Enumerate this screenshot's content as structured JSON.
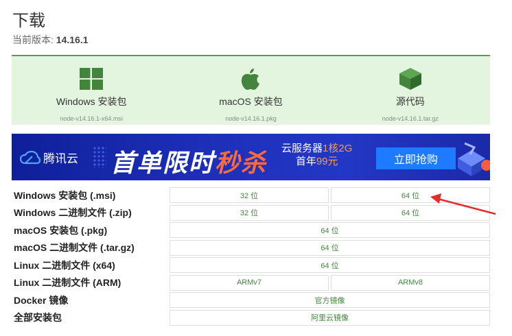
{
  "page": {
    "title": "下载",
    "version_label": "当前版本:",
    "version_value": "14.16.1"
  },
  "downloads": [
    {
      "icon": "windows-icon",
      "name": "Windows 安装包",
      "file": "node-v14.16.1-x64.msi"
    },
    {
      "icon": "apple-icon",
      "name": "macOS 安装包",
      "file": "node-v14.16.1.pkg"
    },
    {
      "icon": "box-icon",
      "name": "源代码",
      "file": "node-v14.16.1.tar.gz"
    }
  ],
  "banner": {
    "brand": "腾讯云",
    "headline_part1": "首单限时",
    "headline_part2": "秒杀",
    "sub_line1_a": "云服务器",
    "sub_line1_b": "1核2G",
    "sub_line2_a": "首年",
    "sub_line2_b": "99元",
    "button": "立即抢购"
  },
  "table": [
    {
      "label": "Windows 安装包 (.msi)",
      "cells": [
        "32 位",
        "64 位"
      ]
    },
    {
      "label": "Windows 二进制文件 (.zip)",
      "cells": [
        "32 位",
        "64 位"
      ]
    },
    {
      "label": "macOS 安装包 (.pkg)",
      "cells": [
        "64 位"
      ]
    },
    {
      "label": "macOS 二进制文件 (.tar.gz)",
      "cells": [
        "64 位"
      ]
    },
    {
      "label": "Linux 二进制文件 (x64)",
      "cells": [
        "64 位"
      ]
    },
    {
      "label": "Linux 二进制文件 (ARM)",
      "cells": [
        "ARMv7",
        "ARMv8"
      ]
    },
    {
      "label": "Docker 镜像",
      "cells": [
        "官方镜像"
      ]
    },
    {
      "label": "全部安装包",
      "cells": [
        "阿里云镜像"
      ]
    }
  ],
  "colors": {
    "accent_green": "#43853d",
    "panel_bg": "#e4f5df",
    "banner_blue": "#1d2fb8",
    "highlight_orange": "#ff6a3d",
    "annotation_red": "#e52b2b"
  }
}
